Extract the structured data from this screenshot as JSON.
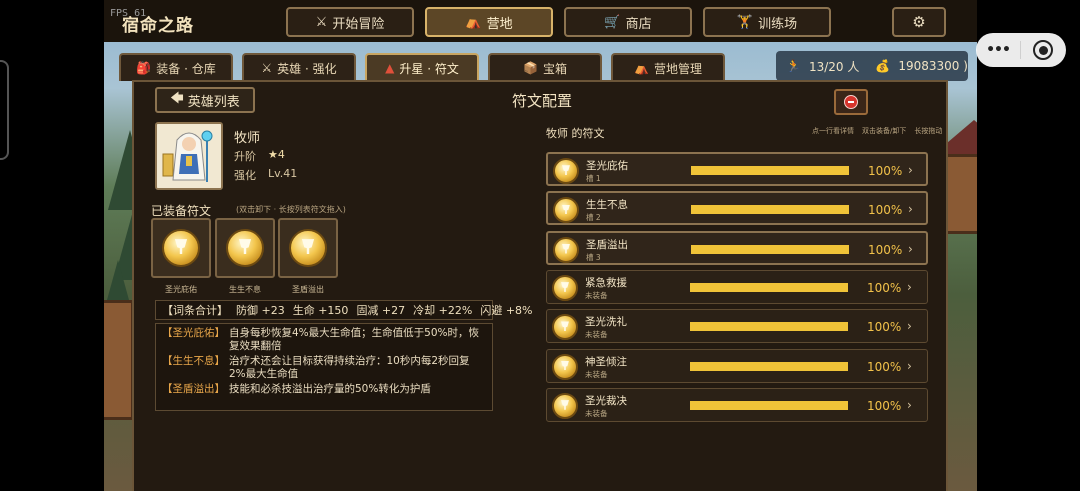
{
  "fps": "FPS 61",
  "game_title": "宿命之路",
  "nav": [
    {
      "icon": "⚔",
      "label": "开始冒险"
    },
    {
      "icon": "⛺",
      "label": "营地"
    },
    {
      "icon": "🛒",
      "label": "商店"
    },
    {
      "icon": "🏋",
      "label": "训练场"
    }
  ],
  "settings_icon": "⚙",
  "subtabs": [
    {
      "icon": "🎒",
      "label": "装备 · 仓库"
    },
    {
      "icon": "⚔",
      "label": "英雄 · 强化"
    },
    {
      "icon": "▲",
      "label": "升星 · 符文"
    },
    {
      "icon": "📦",
      "label": "宝箱"
    },
    {
      "icon": "⛺",
      "label": "营地管理"
    }
  ],
  "stats": {
    "heroes_icon": "🏃",
    "heroes": "13/20 人",
    "gold_icon": "💰",
    "gold": "19083300 )"
  },
  "panel": {
    "back_arrow": "🡄",
    "back_label": "英雄列表",
    "title": "符文配置"
  },
  "hero": {
    "name": "牧师",
    "ascend_label": "升阶",
    "stars": "★4",
    "enhance_label": "强化",
    "level": "Lv.41"
  },
  "equipped": {
    "label": "已装备符文",
    "hint": "(双击卸下 · 长按列表符文拖入)",
    "slots": [
      "圣光庇佑",
      "生生不息",
      "圣盾溢出"
    ]
  },
  "summary": {
    "title": "【词条合计】",
    "items": [
      "防御 +23",
      "生命 +150",
      "固减 +27",
      "冷却 +22%",
      "闪避 +8%"
    ]
  },
  "descriptions": [
    {
      "tag": "【圣光庇佑】",
      "text": "自身每秒恢复4%最大生命值；生命值低于50%时，恢复效果翻倍"
    },
    {
      "tag": "【生生不息】",
      "text": "治疗术还会让目标获得持续治疗：10秒内每2秒回复2%最大生命值"
    },
    {
      "tag": "【圣盾溢出】",
      "text": "技能和必杀技溢出治疗量的50%转化为护盾"
    }
  ],
  "runes_panel": {
    "title": "牧师 的符文",
    "hints": [
      "点一行看详情",
      "双击装备/卸下",
      "长按拖动"
    ]
  },
  "runes": [
    {
      "name": "圣光庇佑",
      "status": "槽 1",
      "progress": 100,
      "pct": "100%",
      "equipped": true
    },
    {
      "name": "生生不息",
      "status": "槽 2",
      "progress": 100,
      "pct": "100%",
      "equipped": true
    },
    {
      "name": "圣盾溢出",
      "status": "槽 3",
      "progress": 100,
      "pct": "100%",
      "equipped": true
    },
    {
      "name": "紧急救援",
      "status": "未装备",
      "progress": 100,
      "pct": "100%",
      "equipped": false
    },
    {
      "name": "圣光洗礼",
      "status": "未装备",
      "progress": 100,
      "pct": "100%",
      "equipped": false
    },
    {
      "name": "神圣倾注",
      "status": "未装备",
      "progress": 100,
      "pct": "100%",
      "equipped": false
    },
    {
      "name": "圣光裁决",
      "status": "未装备",
      "progress": 100,
      "pct": "100%",
      "equipped": false
    }
  ],
  "chevron": "›",
  "capsule": {
    "more": "•••"
  }
}
